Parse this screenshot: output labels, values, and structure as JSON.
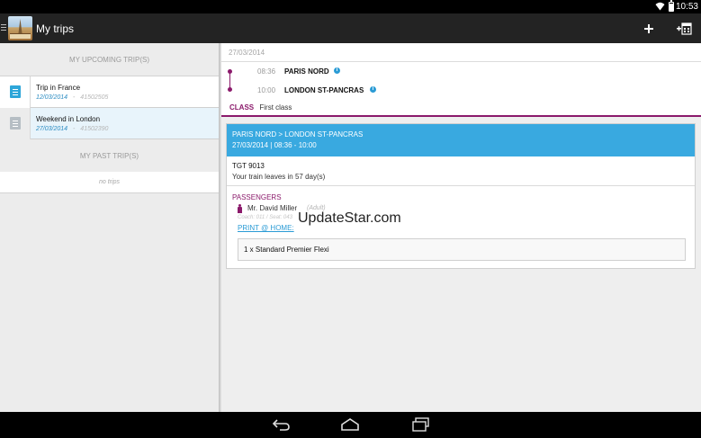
{
  "status_bar": {
    "time": "10:53"
  },
  "action_bar": {
    "title": "My trips"
  },
  "upcoming": {
    "header": "MY UPCOMING TRIP(S)",
    "trips": [
      {
        "name": "Trip in France",
        "date": "12/03/2014",
        "sep": "-",
        "ref": "41502505"
      },
      {
        "name": "Weekend in London",
        "date": "27/03/2014",
        "sep": "-",
        "ref": "41502390"
      }
    ]
  },
  "past": {
    "header": "MY PAST TRIP(S)",
    "empty_text": "no trips"
  },
  "detail": {
    "date": "27/03/2014",
    "itinerary": [
      {
        "time": "08:36",
        "station": "PARIS NORD"
      },
      {
        "time": "10:00",
        "station": "LONDON ST-PANCRAS"
      }
    ],
    "class_label": "CLASS",
    "class_value": "First class",
    "card": {
      "route": "PARIS NORD > LONDON ST-PANCRAS",
      "when": "27/03/2014 | 08:36 - 10:00",
      "train": "TGT 9013",
      "leaves": "Your train leaves in 57 day(s)",
      "passengers_label": "PASSENGERS",
      "passenger_name": "Mr. David Miller",
      "passenger_type": "(Adult)",
      "coach_seat": "Coach: 011 / Seat: 043",
      "print_link": "PRINT @ HOME:",
      "fare": "1 x Standard Premier Flexi"
    }
  },
  "watermark": "UpdateStar.com",
  "colors": {
    "accent": "#8b1a6b",
    "blue": "#39a9e0",
    "info_blue": "#2a9bd5"
  }
}
